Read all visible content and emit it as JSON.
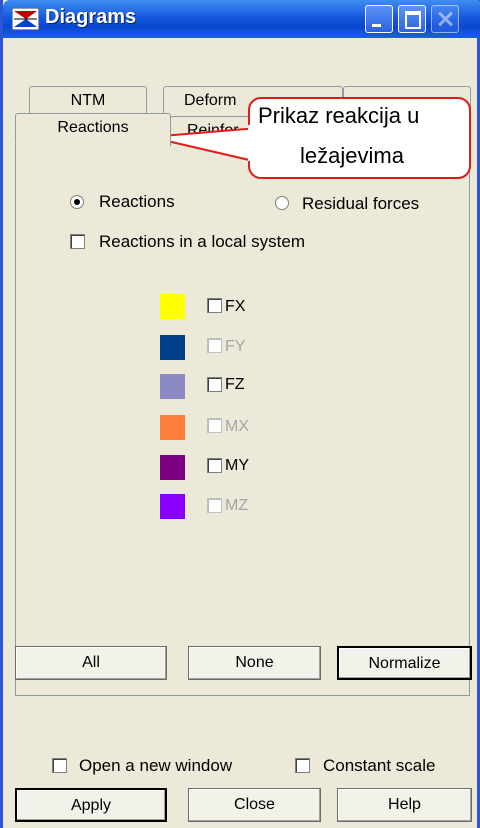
{
  "window": {
    "title": "Diagrams",
    "icon": "diagrams-app-icon"
  },
  "tabs": {
    "row_back": [
      "NTM",
      "Deform"
    ],
    "row_front": [
      "Reactions",
      "Reinfor"
    ]
  },
  "reactions_panel": {
    "radio_reactions": "Reactions",
    "radio_residual": "Residual forces",
    "checkbox_local": "Reactions in a local system",
    "components": [
      {
        "label": "FX",
        "color": "#ffff00",
        "enabled": true
      },
      {
        "label": "FY",
        "color": "#003f87",
        "enabled": false
      },
      {
        "label": "FZ",
        "color": "#8a89c2",
        "enabled": true
      },
      {
        "label": "MX",
        "color": "#ff7f3f",
        "enabled": false
      },
      {
        "label": "MY",
        "color": "#7b0080",
        "enabled": true
      },
      {
        "label": "MZ",
        "color": "#8a00ff",
        "enabled": false
      }
    ],
    "buttons": {
      "all": "All",
      "none": "None",
      "normalize": "Normalize"
    }
  },
  "options": {
    "open_new_window": "Open a new window",
    "constant_scale": "Constant scale"
  },
  "footer": {
    "apply": "Apply",
    "close": "Close",
    "help": "Help"
  },
  "annotation": {
    "line1": "Prikaz reakcija u",
    "line2": "ležajevima"
  }
}
